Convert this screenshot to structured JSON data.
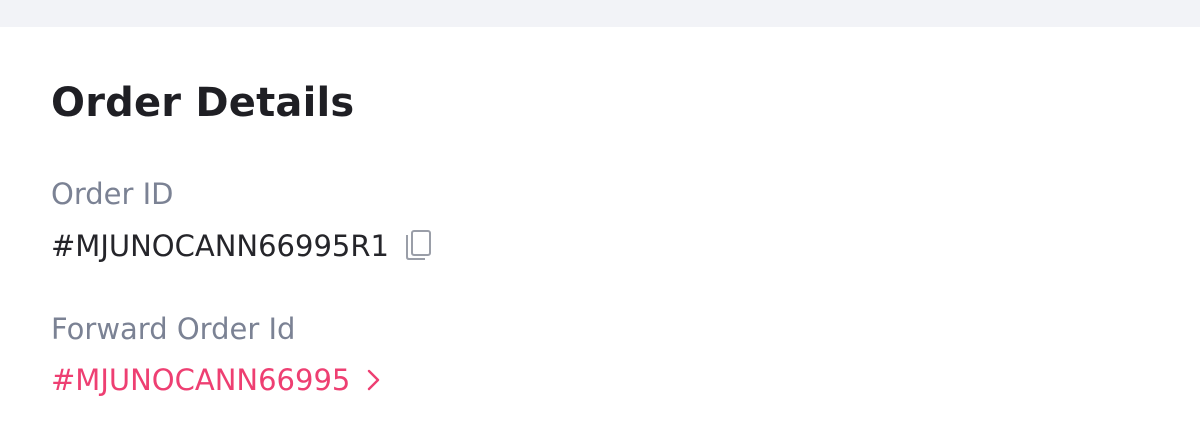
{
  "order_details": {
    "title": "Order Details",
    "order_id_label": "Order ID",
    "order_id_value": "#MJUNOCANN66995R1",
    "forward_order_id_label": "Forward Order Id",
    "forward_order_id_value": "#MJUNOCANN66995"
  },
  "icons": {
    "copy": "copy-icon",
    "chevron": "chevron-right-icon"
  },
  "colors": {
    "accent": "#ee3f72",
    "label": "#7b8294",
    "text": "#25252a",
    "title": "#1f1f24",
    "top_strip": "#f2f3f7"
  }
}
